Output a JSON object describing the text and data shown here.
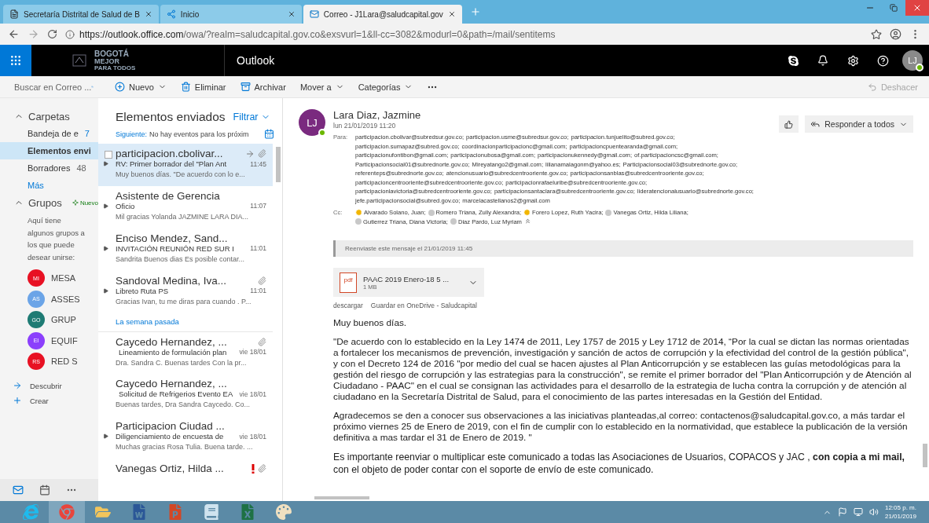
{
  "browser": {
    "tabs": [
      {
        "title": "Secretaría Distrital de Salud de B",
        "kind": "page",
        "selected": false
      },
      {
        "title": "Inicio",
        "kind": "sharepoint",
        "selected": false
      },
      {
        "title": "Correo - J1Lara@saludcapital.gov",
        "kind": "outlook",
        "selected": true
      }
    ],
    "address": {
      "host": "https://outlook.office.com",
      "path": "/owa/?realm=saludcapital.gov.co&exsvurl=1&ll-cc=3082&modurl=0&path=/mail/sentitems"
    }
  },
  "app_bar": {
    "logo": [
      "BOGOTÁ",
      "MEJOR",
      "PARA TODOS"
    ],
    "title": "Outlook",
    "avatar": "LJ"
  },
  "command_bar": {
    "search_placeholder": "Buscar en Correo ...",
    "actions": [
      {
        "label": "Nuevo",
        "kind": "new"
      },
      {
        "label": "Eliminar",
        "kind": "delete"
      },
      {
        "label": "Archivar",
        "kind": "archive"
      },
      {
        "label": "Mover a",
        "kind": "menu"
      },
      {
        "label": "Categorías",
        "kind": "menu"
      },
      {
        "kind": "more"
      }
    ],
    "undo": {
      "label": "Deshacer",
      "disabled": true
    }
  },
  "sidebar": {
    "folders_heading": "Carpetas",
    "folders": [
      {
        "label": "Bandeja de e",
        "count": "7",
        "unread": true,
        "selected": false
      },
      {
        "label": "Elementos envi",
        "selected": true
      },
      {
        "label": "Borradores",
        "count": "48",
        "unread": false,
        "selected": false
      }
    ],
    "more": "Más",
    "groups_heading": "Grupos",
    "new_group": "Nuevo",
    "groups_hint": "Aquí tiene algunos grupos a los que puede desear unirse:",
    "groups": [
      {
        "initials": "MI",
        "name": "MESA",
        "color": "#e81123"
      },
      {
        "initials": "AS",
        "name": "ASSES",
        "color": "#6ba4e7"
      },
      {
        "initials": "GO",
        "name": "GRUP",
        "color": "#1e7b74"
      },
      {
        "initials": "EI",
        "name": "EQUIF",
        "color": "#8b3ffc"
      },
      {
        "initials": "RS",
        "name": "RED S",
        "color": "#e81123"
      }
    ],
    "links": [
      {
        "label": "Descubrir",
        "kind": "discover"
      },
      {
        "label": "Crear",
        "kind": "create"
      }
    ]
  },
  "message_list": {
    "title": "Elementos enviados",
    "filter": "Filtrar",
    "agenda_label": "Siguiente:",
    "agenda_text": "No hay eventos para los próxim",
    "groups": [
      {
        "messages": [
          {
            "sender": "participacion.cbolivar...",
            "subject": "RV: Primer borrador del \"Plan Ant",
            "time": "11:45",
            "preview": "Muy buenos días.   \"De acuerdo con lo e...",
            "selected": true,
            "expandable": true,
            "forwarded": true,
            "attachment": true,
            "important": false
          },
          {
            "sender": "Asistente de Gerencia",
            "subject": "Oficio",
            "time": "11:07",
            "preview": "Mil gracias Yolanda    JAZMINE LARA DIA...",
            "selected": false,
            "expandable": true,
            "forwarded": false,
            "attachment": false,
            "important": false
          },
          {
            "sender": "Enciso Mendez, Sand...",
            "subject": "INVITACIÓN REUNIÓN RED SUR I",
            "time": "11:01",
            "preview": "Sandrita   Buenos dias   Es posible contar...",
            "selected": false,
            "expandable": true,
            "forwarded": false,
            "attachment": false,
            "important": false
          },
          {
            "sender": "Sandoval Medina, Iva...",
            "subject": "Libreto Ruta PS",
            "time": "11:01",
            "preview": "Gracias Ivan, tu me diras para cuando . P...",
            "selected": false,
            "expandable": true,
            "forwarded": false,
            "attachment": true,
            "important": false
          }
        ]
      },
      {
        "heading": "La semana pasada",
        "messages": [
          {
            "sender": "Caycedo Hernandez, ...",
            "subject": "Lineamiento de formulación plan",
            "time": "vie 18/01",
            "preview": "Dra. Sandra C.   Buenas tardes   Con la pr...",
            "selected": false,
            "expandable": false,
            "forwarded": false,
            "attachment": true,
            "important": false
          },
          {
            "sender": "Caycedo Hernandez, ...",
            "subject": "Solicitud de Refrigerios Evento EA",
            "time": "vie 18/01",
            "preview": "Buenas tardes, Dra Sandra Caycedo.   Co...",
            "selected": false,
            "expandable": false,
            "forwarded": false,
            "attachment": false,
            "important": false
          },
          {
            "sender": "Participacion Ciudad ...",
            "subject": "Diligenciamiento de encuesta de",
            "time": "vie 18/01",
            "preview": "Muchas gracias Rosa Tulia. Buena tarde.  ...",
            "selected": false,
            "expandable": true,
            "forwarded": false,
            "attachment": false,
            "important": false
          },
          {
            "sender": "Vanegas Ortiz, Hilda ...",
            "selected": false,
            "expandable": false,
            "forwarded": false,
            "attachment": true,
            "important": true
          }
        ]
      }
    ]
  },
  "reading": {
    "initials": "LJ",
    "sender": "Lara Diaz, Jazmine",
    "date": "lun 21/01/2019 11:20",
    "reply": "Responder a todos",
    "to_label": "Para:",
    "to": [
      "participacion.cbolivar@subredsur.gov.co;",
      "participacion.usme@subredsur.gov.co;",
      "participacion.tunjuelito@subred.gov.co;",
      "participacion.sumapaz@subred.gov.co;",
      "coordinacionparticipacionc@gmail.com;",
      "participacioncpuentearanda@gmail.com;",
      "participacionufontibon@gmail.com;",
      "participacionubosa@gmail.com;",
      "participacionukennedy@gmail.com;",
      "of.participacioncsc@gmail.com;",
      "Participacionsocial01@subrednorte.gov.co;",
      "Mireyatango2@gmail.com;",
      "lilianamalagonm@yahoo.es;",
      "Participacionsocial03@subrednorte.gov.co;",
      "referenteps@subrednorte.gov.co;",
      "atencionusuario@subredcentrooriente.gov.co;",
      "participacionsanblas@subredcentrooriente.gov.co;",
      "participacioncentrooriente@subredcentrooriente.gov.co;",
      "participacionrafaeluribe@subredcentrooriente.gov.co;",
      "participacionlavictoria@subredcentrooriente.gov.co;",
      "participacionsantaclara@subredcentrooriente.gov.co;",
      "lideratencionalusuario@subrednorte.gov.co;",
      "jefe.participacionsocial@subred.gov.co;",
      "marcelacastellanos2@gmail.com"
    ],
    "cc_label": "Cc:",
    "cc": [
      {
        "name": "Alvarado Solano, Juan;",
        "color": "#f2b600"
      },
      {
        "name": "Romero Triana, Zully Alexandra;",
        "color": "#c8c8c8"
      },
      {
        "name": "Forero Lopez, Ruth Yacira;",
        "color": "#f2b600"
      },
      {
        "name": "Vanegas Ortiz, Hilda Liliana;",
        "color": "#c8c8c8"
      },
      {
        "name": "Gutierrez Triana, Diana Victoria;",
        "color": "#c8c8c8"
      },
      {
        "name": "Diaz Pardo, Luz Myriam",
        "color": "#c8c8c8"
      }
    ],
    "forwarded_note": "Reenviaste este mensaje el 21/01/2019 11:45",
    "attachment": {
      "type": "pdf",
      "name": "PAAC 2019 Enero-18 5 ...",
      "size": "1 MB"
    },
    "attachment_actions": [
      "descargar",
      "Guardar en OneDrive - Saludcapital"
    ],
    "body": [
      {
        "text": "Muy buenos días.",
        "kind": "plain"
      },
      {
        "text": "\"De acuerdo con lo establecido en la Ley 1474 de 2011, Ley 1757 de 2015 y Ley 1712 de 2014, “Por la cual se dictan las normas orientadas a fortalecer los mecanismos de prevención, investigación y sanción de actos de corrupción y la efectividad del control de la gestión pública\", y con el Decreto 124 de 2016 \"por medio del cual se hacen ajustes al Plan Anticorrupción y se establecen las guías metodológicas para la gestión del riesgo de corrupción y las estrategias para la construcción\", se remite el primer borrador del \"Plan Anticorrupción y de Atención al Ciudadano - PAAC\" en el cual se consignan las actividades para el desarrollo de la estrategia de lucha contra la corrupción y de atención al ciudadano en la Secretaría Distrital de Salud, para el conocimiento de las partes interesadas en la Gestión del Entidad.",
        "kind": "plain"
      },
      {
        "text": "Agradecemos se den a conocer sus observaciones a las iniciativas planteadas,al correo: contactenos@saludcapital.gov.co, a más tardar el próximo viernes 25 de Enero de 2019, con el fin de cumplir con lo establecido en la normatividad, que establece la publicación de la versión definitiva a mas tardar el 31 de Enero de 2019. \"",
        "kind": "plain"
      },
      {
        "text": "Es importante reenviar o multiplicar este comunicado a todas las Asociaciones de Usuarios, COPACOS y  JAC , **con copia a mi mail,** con el objeto de poder contar con el soporte de envío de este comunicado.",
        "kind": "large"
      }
    ]
  },
  "taskbar": {
    "apps": [
      {
        "kind": "ie",
        "selected": false
      },
      {
        "kind": "chrome",
        "selected": true
      },
      {
        "kind": "explorer",
        "selected": false
      },
      {
        "kind": "word",
        "selected": false
      },
      {
        "kind": "powerpoint",
        "selected": false
      },
      {
        "kind": "notes",
        "selected": false
      },
      {
        "kind": "excel",
        "selected": false
      },
      {
        "kind": "paint",
        "selected": false
      }
    ],
    "time": "12:05 p. m.",
    "date": "21/01/2019"
  }
}
